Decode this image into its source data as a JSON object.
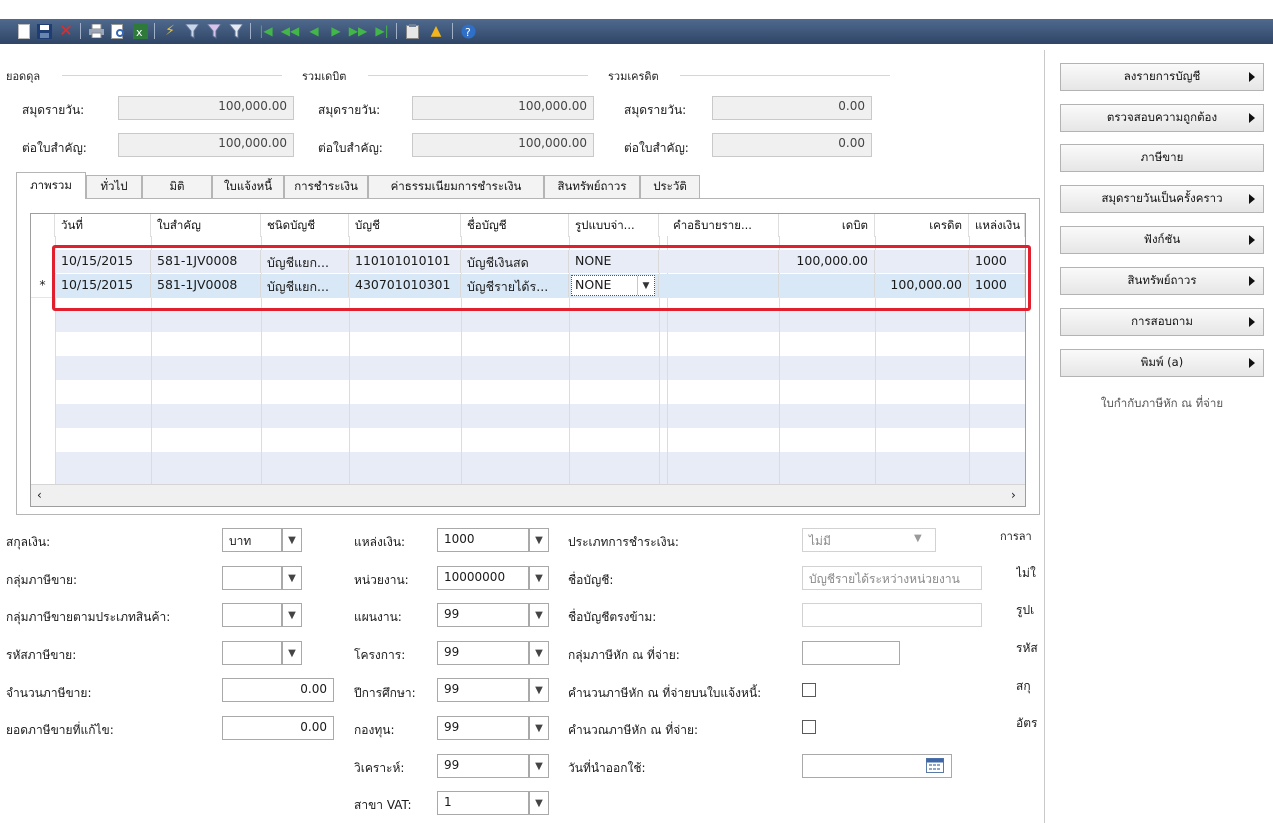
{
  "toolbar": {
    "icons": [
      "new-icon",
      "save-icon",
      "delete-icon",
      "print-icon",
      "print-preview-icon",
      "excel-icon",
      "lightning-icon",
      "filter-clear-icon",
      "filter-icon",
      "funnel-icon",
      "first-record-icon",
      "prev-page-icon",
      "prev-record-icon",
      "next-record-icon",
      "next-page-icon",
      "last-record-icon",
      "clipboard-icon",
      "warning-icon",
      "help-icon"
    ]
  },
  "summary": {
    "balance_label": "ยอดดุล",
    "debit_label": "รวมเดบิต",
    "credit_label": "รวมเครดิต",
    "journal_label": "สมุดรายวัน:",
    "voucher_label": "ต่อใบสำคัญ:",
    "balance_journal": "100,000.00",
    "balance_voucher": "100,000.00",
    "debit_journal": "100,000.00",
    "debit_voucher": "100,000.00",
    "credit_journal": "0.00",
    "credit_voucher": "0.00"
  },
  "tabs": [
    "ภาพรวม",
    "ทั่วไป",
    "มิติ",
    "ใบแจ้งหนี้",
    "การชำระเงิน",
    "ค่าธรรมเนียมการชำระเงิน",
    "สินทรัพย์ถาวร",
    "ประวัติ"
  ],
  "grid": {
    "columns": [
      "วันที่",
      "ใบสำคัญ",
      "ชนิดบัญชี",
      "บัญชี",
      "ชื่อบัญชี",
      "รูปแบบจ่า...",
      "คำอธิบายราย...",
      "เดบิต",
      "เครดิต",
      "แหล่งเงิน"
    ],
    "rows": [
      {
        "marker": "",
        "date": "10/15/2015",
        "voucher": "581-1JV0008",
        "acct_type": "บัญชีแยก...",
        "account": "110101010101",
        "acct_name": "บัญชีเงินสด",
        "pay_format": "NONE",
        "desc": "",
        "debit": "100,000.00",
        "credit": "",
        "fund": "1000"
      },
      {
        "marker": "*",
        "date": "10/15/2015",
        "voucher": "581-1JV0008",
        "acct_type": "บัญชีแยก...",
        "account": "430701010301",
        "acct_name": "บัญชีรายได้ร...",
        "pay_format": "NONE",
        "desc": "",
        "debit": "",
        "credit": "100,000.00",
        "fund": "1000"
      }
    ]
  },
  "form": {
    "currency_label": "สกุลเงิน:",
    "currency_value": "บาท",
    "tax_group_label": "กลุ่มภาษีขาย:",
    "tax_group_value": "",
    "item_tax_group_label": "กลุ่มภาษีขายตามประเภทสินค้า:",
    "item_tax_group_value": "",
    "tax_code_label": "รหัสภาษีขาย:",
    "tax_code_value": "",
    "tax_amount_label": "จำนวนภาษีขาย:",
    "tax_amount_value": "0.00",
    "tax_adjusted_label": "ยอดภาษีขายที่แก้ไข:",
    "tax_adjusted_value": "0.00",
    "fund_label": "แหล่งเงิน:",
    "fund_value": "1000",
    "unit_label": "หน่วยงาน:",
    "unit_value": "10000000",
    "plan_label": "แผนงาน:",
    "plan_value": "99",
    "project_label": "โครงการ:",
    "project_value": "99",
    "edu_year_label": "ปีการศึกษา:",
    "edu_year_value": "99",
    "funds_label": "กองทุน:",
    "funds_value": "99",
    "analysis_label": "วิเคราะห์:",
    "analysis_value": "99",
    "vat_branch_label": "สาขา VAT:",
    "vat_branch_value": "1",
    "payment_type_label": "ประเภทการชำระเงิน:",
    "payment_type_value": "ไม่มี",
    "account_name_label": "ชื่อบัญชี:",
    "account_name_value": "บัญชีรายได้ระหว่างหน่วยงาน",
    "offset_name_label": "ชื่อบัญชีตรงข้าม:",
    "offset_name_value": "",
    "wht_group_label": "กลุ่มภาษีหัก ณ ที่จ่าย:",
    "wht_group_value": "",
    "wht_invoice_label": "คำนวนภาษีหัก ณ ที่จ่ายบนใบแจ้งหนี้:",
    "wht_calc_label": "คำนวณภาษีหัก ณ ที่จ่าย:",
    "doc_date_label": "วันที่นำออกใช้:",
    "doc_date_value": "",
    "right_partial": [
      "การลา",
      "ไม่ใ",
      "รูปเ",
      "รหัส",
      "สกุ",
      "อัตร"
    ]
  },
  "side_buttons": [
    {
      "label": "ลงรายการบัญชี",
      "arrow": true,
      "enabled": true
    },
    {
      "label": "ตรวจสอบความถูกต้อง",
      "arrow": true,
      "enabled": true
    },
    {
      "label": "ภาษีขาย",
      "arrow": false,
      "enabled": true
    },
    {
      "label": "สมุดรายวันเป็นครั้งคราว",
      "arrow": true,
      "enabled": true
    },
    {
      "label": "ฟังก์ชัน",
      "arrow": true,
      "enabled": true
    },
    {
      "label": "สินทรัพย์ถาวร",
      "arrow": true,
      "enabled": true
    },
    {
      "label": "การสอบถาม",
      "arrow": true,
      "enabled": true
    },
    {
      "label": "พิมพ์ (a)",
      "arrow": true,
      "enabled": true
    },
    {
      "label": "ใบกำกับภาษีหัก ณ ที่จ่าย",
      "arrow": false,
      "enabled": false
    }
  ],
  "colors": {
    "toolbar_band": "#3c5678",
    "row_even": "#e8ecf6",
    "selected_row": "#d8e8f7",
    "highlight": "#e0202f"
  }
}
